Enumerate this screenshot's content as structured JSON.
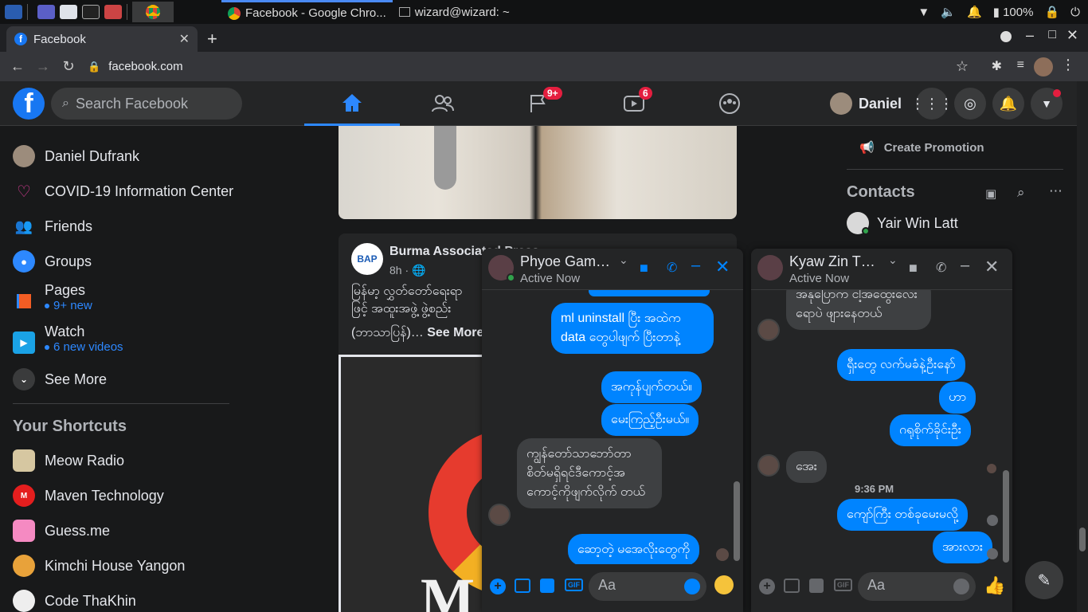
{
  "taskbar": {
    "tasks": [
      "Facebook - Google Chro...",
      "wizard@wizard: ~"
    ],
    "battery": "100%"
  },
  "browser": {
    "tab_title": "Facebook",
    "url": "facebook.com"
  },
  "header": {
    "search_placeholder": "Search Facebook",
    "groups_badge": "9+",
    "watch_badge": "6",
    "profile_name": "Daniel"
  },
  "sidebar": {
    "items": [
      {
        "label": "Daniel Dufrank"
      },
      {
        "label": "COVID-19 Information Center"
      },
      {
        "label": "Friends"
      },
      {
        "label": "Groups"
      },
      {
        "label": "Pages",
        "sub": "9+ new"
      },
      {
        "label": "Watch",
        "sub": "6 new videos"
      },
      {
        "label": "See More"
      }
    ],
    "shortcuts_title": "Your Shortcuts",
    "shortcuts": [
      "Meow Radio",
      "Maven Technology",
      "Guess.me",
      "Kimchi House Yangon",
      "Code ThaKhin"
    ]
  },
  "post": {
    "page_name": "Burma Associated Press",
    "time": "8h ·",
    "avatar_text": "BAP",
    "text_line1": "မြန်မာ့ လွှတ်တော်ရေးရာ",
    "text_line2": "ဖြင့် အထူးအဖွဲ့ ဖွဲ့စည်း",
    "text_line3": "(ဘာသာပြန်)…",
    "see_more": "See More",
    "image_text": "M"
  },
  "right": {
    "create_promotion": "Create Promotion",
    "contacts_title": "Contacts",
    "contacts": [
      "Yair Win Latt"
    ]
  },
  "chat1": {
    "name": "Phyoe Gam…",
    "status": "Active Now",
    "messages": [
      {
        "from": "me",
        "text": "ml uninstall ပြီး အထဲက data တွေပါဖျက် ပြီးတာနဲ့"
      },
      {
        "from": "me",
        "text": "အကုန်ပျက်တယ်။"
      },
      {
        "from": "me",
        "text": "မေးကြည့်ဦးမယ်။"
      },
      {
        "from": "them",
        "text": "ကျွန်တော်သာဘော်တာ စိတ်မရှိရင်ဒီကောင့်အ ကောင့်ကိုဖျက်လိုက် တယ်"
      },
      {
        "from": "me",
        "text": "ဆော့တဲ့ မအေလိုးတွေကို"
      }
    ],
    "input_placeholder": "Aa"
  },
  "chat2": {
    "name": "Kyaw Zin T…",
    "status": "Active Now",
    "messages": [
      {
        "from": "them",
        "text": "အနုပြောက ငါ့အထွေးလေးရောပဲ ဖျားနေတယ်"
      },
      {
        "from": "me",
        "text": "ရှီးတွေ လက်မခံနဲ့ဦးနော်"
      },
      {
        "from": "me",
        "text": "ဟာ"
      },
      {
        "from": "me",
        "text": "ဂရုစိုက်ခိုင်းဦး"
      },
      {
        "from": "them",
        "text": "အေး"
      },
      {
        "from": "me",
        "text": "ကျော်ကြီး တစ်ခုမေးမလို့"
      },
      {
        "from": "me",
        "text": "အားလား"
      }
    ],
    "timestamp": "9:36 PM",
    "input_placeholder": "Aa"
  }
}
